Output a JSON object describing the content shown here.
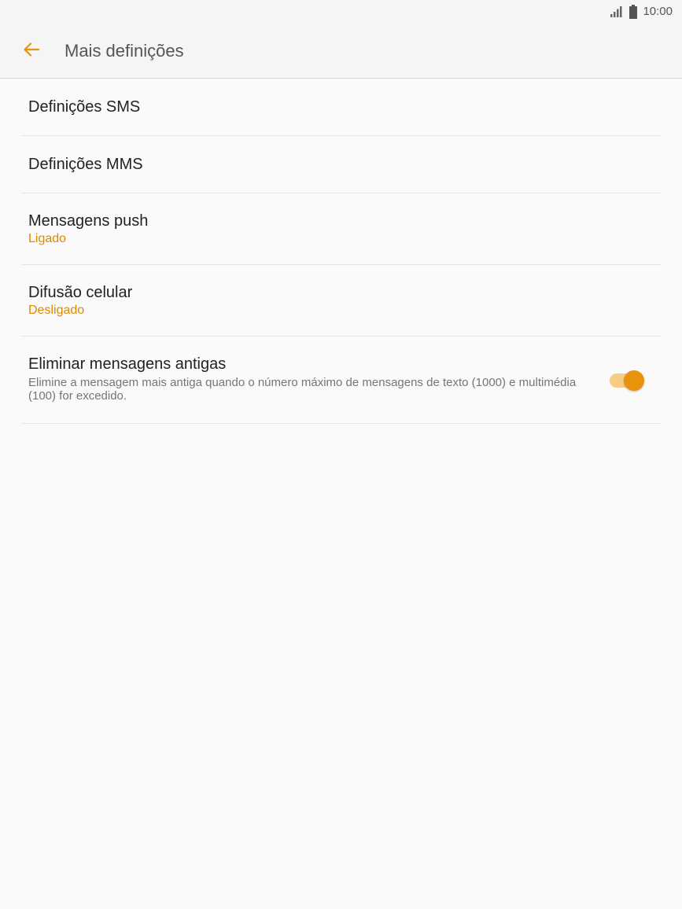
{
  "status_bar": {
    "time": "10:00",
    "signal_icon": "signal-icon",
    "battery_icon": "battery-icon"
  },
  "app_bar": {
    "back_icon": "arrow-back-icon",
    "title": "Mais definições"
  },
  "settings": {
    "items": [
      {
        "title": "Definições SMS"
      },
      {
        "title": "Definições MMS"
      },
      {
        "title": "Mensagens push",
        "status": "Ligado"
      },
      {
        "title": "Difusão celular",
        "status": "Desligado"
      },
      {
        "title": "Eliminar mensagens antigas",
        "description": "Elimine a mensagem mais antiga quando o número máximo de mensagens de texto (1000) e multimédia (100) for excedido.",
        "toggle_on": true
      }
    ]
  },
  "colors": {
    "accent": "#e8930c",
    "accent_light": "#f7cc84",
    "status_text": "#d98c00",
    "background": "#fafafa"
  }
}
